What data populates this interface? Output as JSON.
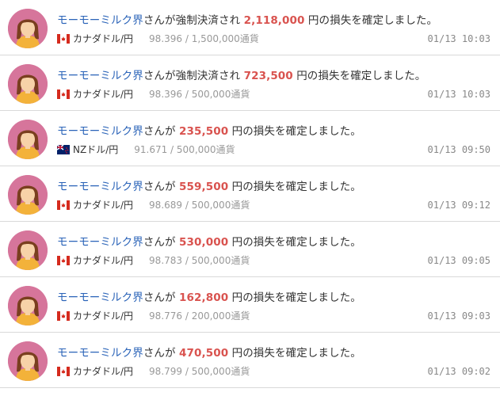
{
  "items": [
    {
      "user": "モーモーミルク界",
      "pre": "さんが強制決済され ",
      "amount": "2,118,000",
      "post": " 円の損失を確定しました。",
      "flag": "ca-flag-icon",
      "pair": "カナダドル/円",
      "rate": "98.396 / 1,500,000通貨",
      "time": "01/13 10:03"
    },
    {
      "user": "モーモーミルク界",
      "pre": "さんが強制決済され ",
      "amount": "723,500",
      "post": " 円の損失を確定しました。",
      "flag": "ca-flag-icon",
      "pair": "カナダドル/円",
      "rate": "98.396 / 500,000通貨",
      "time": "01/13 10:03"
    },
    {
      "user": "モーモーミルク界",
      "pre": "さんが ",
      "amount": "235,500",
      "post": " 円の損失を確定しました。",
      "flag": "nz-flag-icon",
      "pair": "NZドル/円",
      "rate": "91.671 / 500,000通貨",
      "time": "01/13 09:50"
    },
    {
      "user": "モーモーミルク界",
      "pre": "さんが ",
      "amount": "559,500",
      "post": " 円の損失を確定しました。",
      "flag": "ca-flag-icon",
      "pair": "カナダドル/円",
      "rate": "98.689 / 500,000通貨",
      "time": "01/13 09:12"
    },
    {
      "user": "モーモーミルク界",
      "pre": "さんが ",
      "amount": "530,000",
      "post": " 円の損失を確定しました。",
      "flag": "ca-flag-icon",
      "pair": "カナダドル/円",
      "rate": "98.783 / 500,000通貨",
      "time": "01/13 09:05"
    },
    {
      "user": "モーモーミルク界",
      "pre": "さんが ",
      "amount": "162,800",
      "post": " 円の損失を確定しました。",
      "flag": "ca-flag-icon",
      "pair": "カナダドル/円",
      "rate": "98.776 / 200,000通貨",
      "time": "01/13 09:03"
    },
    {
      "user": "モーモーミルク界",
      "pre": "さんが ",
      "amount": "470,500",
      "post": " 円の損失を確定しました。",
      "flag": "ca-flag-icon",
      "pair": "カナダドル/円",
      "rate": "98.799 / 500,000通貨",
      "time": "01/13 09:02"
    }
  ],
  "colors": {
    "user": "#2a63b8",
    "amount": "#d9534f",
    "avatar_bg": "#d6759b"
  }
}
